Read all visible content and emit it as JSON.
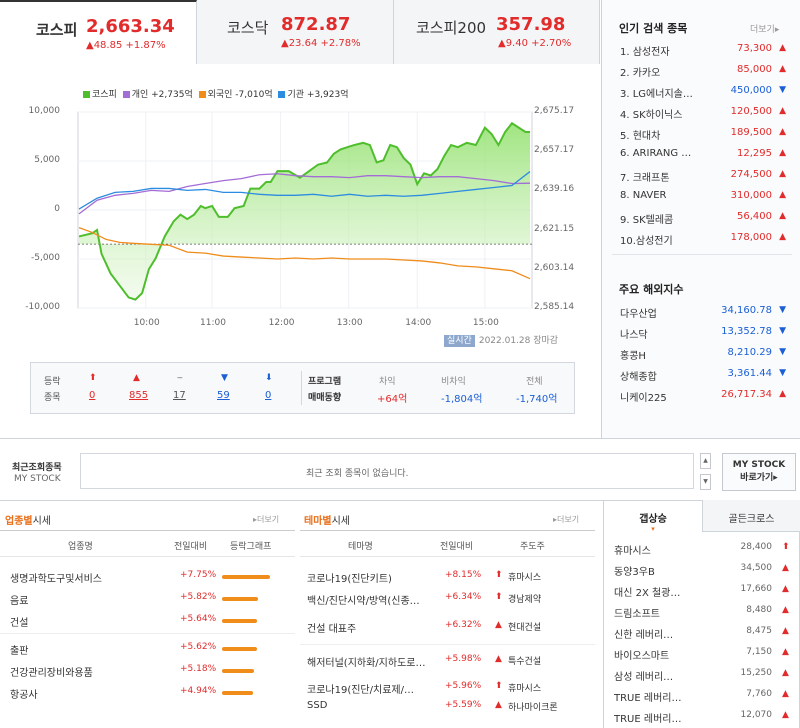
{
  "tabs": [
    {
      "name": "코스피",
      "value": "2,663.34",
      "change": "▲48.85 +1.87%"
    },
    {
      "name": "코스닥",
      "value": "872.87",
      "change": "▲23.64 +2.78%"
    },
    {
      "name": "코스피200",
      "value": "357.98",
      "change": "▲9.40 +2.70%"
    }
  ],
  "legend": {
    "kospi": "코스피",
    "individual": "개인 +2,735억",
    "foreign": "외국인 -7,010억",
    "institution": "기관 +3,923억",
    "colors": {
      "kospi": "#4fbe2c",
      "individual": "#a36cd6",
      "foreign": "#f08c1a",
      "institution": "#2c8cdf"
    }
  },
  "chart_data": {
    "type": "line",
    "x_ticks": [
      "10:00",
      "11:00",
      "12:00",
      "13:00",
      "14:00",
      "15:00"
    ],
    "y_left_ticks": [
      "10,000",
      "5,000",
      "0",
      "-5,000",
      "-10,000"
    ],
    "y_right_ticks": [
      "2,675.17",
      "2,657.17",
      "2,639.16",
      "2,621.15",
      "2,603.14",
      "2,585.14"
    ],
    "ylim_left": [
      -10000,
      10000
    ],
    "ylim_right": [
      2585.14,
      2675.17
    ],
    "baseline_right": 2614.49,
    "series": [
      {
        "name": "코스피",
        "axis": "right",
        "color": "#4fbe2c",
        "values": [
          [
            0,
            2618
          ],
          [
            0.03,
            2619.5
          ],
          [
            0.04,
            2621
          ],
          [
            0.05,
            2610
          ],
          [
            0.07,
            2601
          ],
          [
            0.11,
            2590
          ],
          [
            0.125,
            2589
          ],
          [
            0.14,
            2592
          ],
          [
            0.155,
            2603
          ],
          [
            0.17,
            2608
          ],
          [
            0.19,
            2618
          ],
          [
            0.21,
            2625
          ],
          [
            0.225,
            2628
          ],
          [
            0.24,
            2626
          ],
          [
            0.255,
            2628
          ],
          [
            0.27,
            2632
          ],
          [
            0.28,
            2631
          ],
          [
            0.295,
            2632
          ],
          [
            0.31,
            2627
          ],
          [
            0.33,
            2627
          ],
          [
            0.345,
            2631
          ],
          [
            0.365,
            2632
          ],
          [
            0.38,
            2640
          ],
          [
            0.4,
            2640
          ],
          [
            0.415,
            2643
          ],
          [
            0.425,
            2643
          ],
          [
            0.44,
            2648
          ],
          [
            0.465,
            2648
          ],
          [
            0.49,
            2645
          ],
          [
            0.51,
            2648
          ],
          [
            0.53,
            2651
          ],
          [
            0.55,
            2652
          ],
          [
            0.565,
            2656
          ],
          [
            0.58,
            2658
          ],
          [
            0.595,
            2659
          ],
          [
            0.61,
            2660
          ],
          [
            0.63,
            2661
          ],
          [
            0.645,
            2660
          ],
          [
            0.66,
            2652
          ],
          [
            0.675,
            2653
          ],
          [
            0.69,
            2660
          ],
          [
            0.705,
            2659
          ],
          [
            0.72,
            2654
          ],
          [
            0.735,
            2651
          ],
          [
            0.75,
            2642
          ],
          [
            0.765,
            2647
          ],
          [
            0.78,
            2646
          ],
          [
            0.795,
            2649
          ],
          [
            0.81,
            2655
          ],
          [
            0.825,
            2660
          ],
          [
            0.84,
            2659
          ],
          [
            0.86,
            2661
          ],
          [
            0.88,
            2660
          ],
          [
            0.9,
            2668
          ],
          [
            0.915,
            2665
          ],
          [
            0.93,
            2660
          ],
          [
            0.945,
            2666
          ],
          [
            0.96,
            2670
          ],
          [
            0.975,
            2668
          ],
          [
            0.99,
            2666
          ],
          [
            1.0,
            2666
          ]
        ]
      },
      {
        "name": "개인",
        "axis": "left",
        "color": "#a36cd6",
        "values": [
          [
            0,
            -400
          ],
          [
            0.04,
            1000
          ],
          [
            0.08,
            1500
          ],
          [
            0.12,
            1700
          ],
          [
            0.16,
            2000
          ],
          [
            0.2,
            1900
          ],
          [
            0.24,
            2400
          ],
          [
            0.28,
            2700
          ],
          [
            0.32,
            3000
          ],
          [
            0.36,
            3200
          ],
          [
            0.4,
            3600
          ],
          [
            0.44,
            3700
          ],
          [
            0.48,
            3500
          ],
          [
            0.52,
            3400
          ],
          [
            0.56,
            3400
          ],
          [
            0.6,
            3300
          ],
          [
            0.64,
            3500
          ],
          [
            0.68,
            3500
          ],
          [
            0.72,
            3400
          ],
          [
            0.76,
            3300
          ],
          [
            0.8,
            3400
          ],
          [
            0.84,
            3400
          ],
          [
            0.88,
            3200
          ],
          [
            0.92,
            3000
          ],
          [
            0.96,
            2700
          ],
          [
            1.0,
            2735
          ]
        ]
      },
      {
        "name": "외국인",
        "axis": "left",
        "color": "#f08c1a",
        "values": [
          [
            0,
            -1800
          ],
          [
            0.03,
            -2300
          ],
          [
            0.06,
            -3000
          ],
          [
            0.09,
            -3300
          ],
          [
            0.12,
            -3400
          ],
          [
            0.16,
            -3500
          ],
          [
            0.2,
            -3600
          ],
          [
            0.24,
            -4300
          ],
          [
            0.28,
            -4400
          ],
          [
            0.32,
            -4700
          ],
          [
            0.36,
            -4800
          ],
          [
            0.4,
            -4900
          ],
          [
            0.44,
            -5000
          ],
          [
            0.48,
            -4900
          ],
          [
            0.52,
            -5000
          ],
          [
            0.56,
            -4900
          ],
          [
            0.6,
            -5000
          ],
          [
            0.64,
            -5000
          ],
          [
            0.68,
            -5000
          ],
          [
            0.72,
            -5100
          ],
          [
            0.76,
            -5200
          ],
          [
            0.8,
            -5400
          ],
          [
            0.84,
            -5700
          ],
          [
            0.88,
            -5800
          ],
          [
            0.92,
            -6000
          ],
          [
            0.96,
            -6200
          ],
          [
            1.0,
            -7010
          ]
        ]
      },
      {
        "name": "기관",
        "axis": "left",
        "color": "#2c8cdf",
        "values": [
          [
            0,
            100
          ],
          [
            0.04,
            1200
          ],
          [
            0.08,
            1800
          ],
          [
            0.12,
            1900
          ],
          [
            0.16,
            2200
          ],
          [
            0.2,
            2200
          ],
          [
            0.24,
            2000
          ],
          [
            0.28,
            2100
          ],
          [
            0.32,
            1800
          ],
          [
            0.36,
            1800
          ],
          [
            0.4,
            1600
          ],
          [
            0.44,
            1500
          ],
          [
            0.48,
            1500
          ],
          [
            0.52,
            1600
          ],
          [
            0.56,
            1400
          ],
          [
            0.6,
            1600
          ],
          [
            0.64,
            1400
          ],
          [
            0.68,
            1500
          ],
          [
            0.72,
            1400
          ],
          [
            0.76,
            1500
          ],
          [
            0.8,
            1700
          ],
          [
            0.84,
            1900
          ],
          [
            0.88,
            2100
          ],
          [
            0.92,
            2300
          ],
          [
            0.96,
            2500
          ],
          [
            1.0,
            3923
          ]
        ]
      }
    ]
  },
  "timestamp": {
    "badge": "실시간",
    "date": "2022.01.28",
    "status": "장마감"
  },
  "stats": {
    "label_a": "등락",
    "label_b": "종목",
    "items": [
      {
        "sym": "⬆",
        "val": "0",
        "c": "red"
      },
      {
        "sym": "▲",
        "val": "855",
        "c": "red"
      },
      {
        "sym": "‒",
        "val": "17",
        "c": "gray"
      },
      {
        "sym": "▼",
        "val": "59",
        "c": "blue"
      },
      {
        "sym": "⬇",
        "val": "0",
        "c": "blue"
      }
    ],
    "prog_a": "프로그램",
    "prog_b": "매매동향",
    "cols": [
      {
        "h": "차익",
        "v": "+64억",
        "c": "red"
      },
      {
        "h": "비차익",
        "v": "-1,804억",
        "c": "blue"
      },
      {
        "h": "전체",
        "v": "-1,740억",
        "c": "blue"
      }
    ]
  },
  "popular": {
    "title": "인기 검색 종목",
    "more": "더보기",
    "items": [
      {
        "n": "1. 삼성전자",
        "v": "73,300",
        "a": "▲",
        "c": "red"
      },
      {
        "n": "2. 카카오",
        "v": "85,000",
        "a": "▲",
        "c": "red"
      },
      {
        "n": "3. LG에너지솔…",
        "v": "450,000",
        "a": "▼",
        "c": "blue"
      },
      {
        "n": "4. SK하이닉스",
        "v": "120,500",
        "a": "▲",
        "c": "red"
      },
      {
        "n": "5. 현대차",
        "v": "189,500",
        "a": "▲",
        "c": "red"
      },
      {
        "n": "6. ARIRANG …",
        "v": "12,295",
        "a": "▲",
        "c": "red"
      },
      {
        "n": "7. 크래프톤",
        "v": "274,500",
        "a": "▲",
        "c": "red"
      },
      {
        "n": "8. NAVER",
        "v": "310,000",
        "a": "▲",
        "c": "red"
      },
      {
        "n": "9. SK텔레콤",
        "v": "56,400",
        "a": "▲",
        "c": "red"
      },
      {
        "n": "10.삼성전기",
        "v": "178,000",
        "a": "▲",
        "c": "red"
      }
    ]
  },
  "overseas": {
    "title": "주요 해외지수",
    "items": [
      {
        "n": "다우산업",
        "v": "34,160.78",
        "a": "▼",
        "c": "blue"
      },
      {
        "n": "나스닥",
        "v": "13,352.78",
        "a": "▼",
        "c": "blue"
      },
      {
        "n": "홍콩H",
        "v": "8,210.29",
        "a": "▼",
        "c": "blue"
      },
      {
        "n": "상해종합",
        "v": "3,361.44",
        "a": "▼",
        "c": "blue"
      },
      {
        "n": "니케이225",
        "v": "26,717.34",
        "a": "▲",
        "c": "red"
      }
    ]
  },
  "mystock": {
    "label_a": "최근조회종목",
    "label_b": "MY STOCK",
    "empty": "최근 조회 종목이 없습니다.",
    "btn_a": "MY STOCK",
    "btn_b": "바로가기"
  },
  "industry": {
    "title_a": "업종별",
    "title_b": "시세",
    "more": "더보기",
    "headers": [
      "업종명",
      "전일대비",
      "등락그래프"
    ],
    "rows": [
      {
        "n": "생명과학도구및서비스",
        "p": "+7.75%",
        "w": 1.0
      },
      {
        "n": "음료",
        "p": "+5.82%",
        "w": 0.75
      },
      {
        "n": "건설",
        "p": "+5.64%",
        "w": 0.72
      },
      {
        "n": "출판",
        "p": "+5.62%",
        "w": 0.72
      },
      {
        "n": "건강관리장비와용품",
        "p": "+5.18%",
        "w": 0.67
      },
      {
        "n": "항공사",
        "p": "+4.94%",
        "w": 0.64
      }
    ]
  },
  "theme": {
    "title_a": "테마별",
    "title_b": "시세",
    "more": "더보기",
    "headers": [
      "테마명",
      "전일대비",
      "주도주"
    ],
    "rows": [
      {
        "n": "코로나19(진단키트)",
        "p": "+8.15%",
        "s": "⬆",
        "l": "휴마시스"
      },
      {
        "n": "백신/진단시약/방역(신종…",
        "p": "+6.34%",
        "s": "⬆",
        "l": "경남제약"
      },
      {
        "n": "건설 대표주",
        "p": "+6.32%",
        "s": "▲",
        "l": "현대건설"
      },
      {
        "n": "해저터널(지하화/지하도로…",
        "p": "+5.98%",
        "s": "▲",
        "l": "특수건설"
      },
      {
        "n": "코로나19(진단/치료제/…",
        "p": "+5.96%",
        "s": "⬆",
        "l": "휴마시스"
      },
      {
        "n": "SSD",
        "p": "+5.59%",
        "s": "▲",
        "l": "하나마이크론"
      }
    ]
  },
  "surge": {
    "tab_active": "갭상승",
    "tab_other": "골든크로스",
    "rows": [
      {
        "n": "휴마시스",
        "v": "28,400",
        "a": "⬆"
      },
      {
        "n": "동양3우B",
        "v": "34,500",
        "a": "▲"
      },
      {
        "n": "대신 2X 철광…",
        "v": "17,660",
        "a": "▲"
      },
      {
        "n": "드림소프트",
        "v": "8,480",
        "a": "▲"
      },
      {
        "n": "신한 레버리…",
        "v": "8,475",
        "a": "▲"
      },
      {
        "n": "바이오스마트",
        "v": "7,150",
        "a": "▲"
      },
      {
        "n": "삼성 레버리…",
        "v": "15,250",
        "a": "▲"
      },
      {
        "n": "TRUE 레버리…",
        "v": "7,760",
        "a": "▲"
      },
      {
        "n": "TRUE 레버리…",
        "v": "12,070",
        "a": "▲"
      }
    ]
  }
}
